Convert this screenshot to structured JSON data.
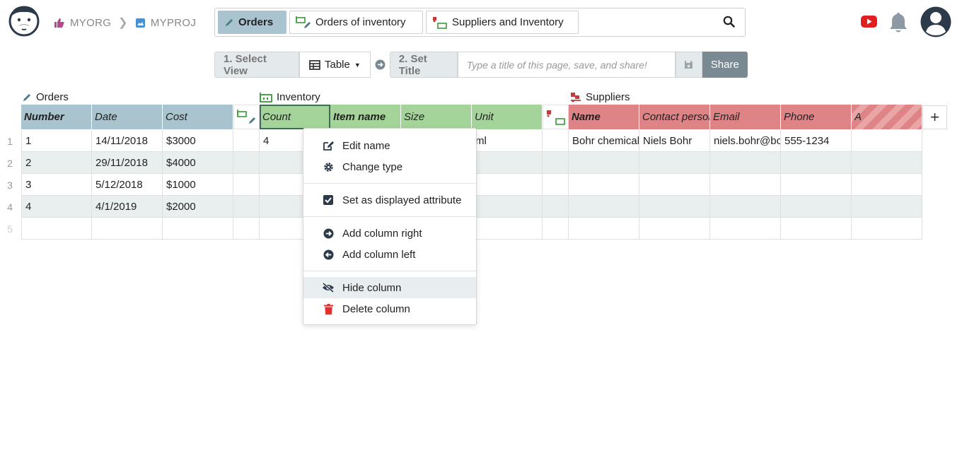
{
  "breadcrumb": {
    "org": "MYORG",
    "project": "MYPROJ"
  },
  "tabs": [
    {
      "label": "Orders"
    },
    {
      "label": "Orders of inventory"
    },
    {
      "label": "Suppliers and Inventory"
    }
  ],
  "toolbar": {
    "step1": "1. Select View",
    "view_type": "Table",
    "step2": "2. Set Title",
    "title_placeholder": "Type a title of this page, save, and share!",
    "share": "Share"
  },
  "groups": {
    "orders": "Orders",
    "inventory": "Inventory",
    "suppliers": "Suppliers"
  },
  "columns": {
    "number": "Number",
    "date": "Date",
    "cost": "Cost",
    "count": "Count",
    "item_name": "Item name",
    "size": "Size",
    "unit": "Unit",
    "name": "Name",
    "contact": "Contact person",
    "email": "Email",
    "phone": "Phone",
    "a": "A"
  },
  "rows": [
    {
      "n": "1",
      "number": "1",
      "date": "14/11/2018",
      "cost": "$3000",
      "count": "4",
      "unit": "ml",
      "name": "Bohr chemicals",
      "contact": "Niels Bohr",
      "email": "niels.bohr@bohr.com",
      "phone": "555-1234"
    },
    {
      "n": "2",
      "number": "2",
      "date": "29/11/2018",
      "cost": "$4000"
    },
    {
      "n": "3",
      "number": "3",
      "date": "5/12/2018",
      "cost": "$1000"
    },
    {
      "n": "4",
      "number": "4",
      "date": "4/1/2019",
      "cost": "$2000"
    },
    {
      "n": "5"
    }
  ],
  "menu": {
    "edit_name": "Edit name",
    "change_type": "Change type",
    "set_displayed": "Set as displayed attribute",
    "add_right": "Add column right",
    "add_left": "Add column left",
    "hide": "Hide column",
    "delete": "Delete column"
  },
  "colors": {
    "orders": "#a9c4cf",
    "inventory": "#a5d49a",
    "suppliers": "#de8386",
    "accent_red": "#d62b2b"
  }
}
